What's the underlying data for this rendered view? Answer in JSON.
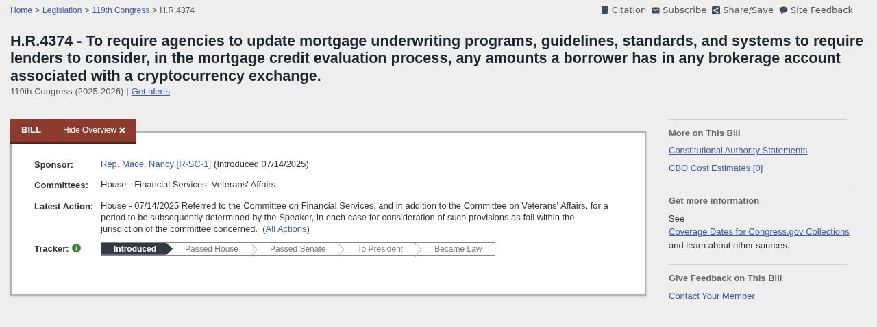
{
  "breadcrumbs": {
    "separator": ">",
    "items": [
      {
        "label": "Home",
        "kind": "link"
      },
      {
        "label": "Legislation",
        "kind": "link"
      },
      {
        "label": "119th Congress",
        "kind": "link"
      },
      {
        "label": "H.R.4374",
        "kind": "current"
      }
    ]
  },
  "header_actions": [
    {
      "label": "Citation",
      "kind": "citation"
    },
    {
      "label": "Subscribe",
      "kind": "subscribe"
    },
    {
      "label": "Share/Save",
      "kind": "share"
    },
    {
      "label": "Site Feedback",
      "kind": "feedback"
    }
  ],
  "title": "H.R.4374 - To require agencies to update mortgage underwriting programs, guidelines, standards, and systems to require lenders to consider, in the mortgage credit evaluation process, any amounts a borrower has in any brokerage account associated with a cryptocurrency exchange.",
  "subtitle": {
    "text": "119th Congress (2025-2026)",
    "divider": "|",
    "link": "Get alerts"
  },
  "tab": {
    "label": "BILL",
    "toggle": "Hide Overview"
  },
  "overview": [
    {
      "label": "Sponsor:",
      "kind": "sponsor",
      "link": "Rep. Mace, Nancy [R-SC-1]",
      "text": "(Introduced 07/14/2025)"
    },
    {
      "label": "Committees:",
      "kind": "text",
      "text": "House - Financial Services; Veterans' Affairs"
    },
    {
      "label": "Latest Action:",
      "kind": "action",
      "text": "House - 07/14/2025 Referred to the Committee on Financial Services, and in addition to the Committee on Veterans' Affairs, for a period to be subsequently determined by the Speaker, in each case for consideration of such provisions as fall within the jurisdiction of the committee concerned.  (",
      "link": "All Actions",
      "after": ")"
    }
  ],
  "tracker": {
    "label": "Tracker:",
    "steps": [
      {
        "label": "Introduced",
        "selected": true
      },
      {
        "label": "Passed House",
        "selected": false
      },
      {
        "label": "Passed Senate",
        "selected": false
      },
      {
        "label": "To President",
        "selected": false
      },
      {
        "label": "Became Law",
        "selected": false
      }
    ]
  },
  "sidebar": [
    {
      "heading": "More on This Bill",
      "items": [
        {
          "kind": "link",
          "text": "Constitutional Authority Statements"
        },
        {
          "kind": "link",
          "text": "CBO Cost Estimates [0]"
        }
      ]
    },
    {
      "heading": "Get more information",
      "items": [
        {
          "kind": "text",
          "before": "See ",
          "link": "Coverage Dates for Congress.gov Collections",
          "after": " and learn about other sources."
        }
      ]
    },
    {
      "heading": "Give Feedback on This Bill",
      "items": [
        {
          "kind": "link",
          "text": "Contact Your Member"
        }
      ]
    }
  ]
}
